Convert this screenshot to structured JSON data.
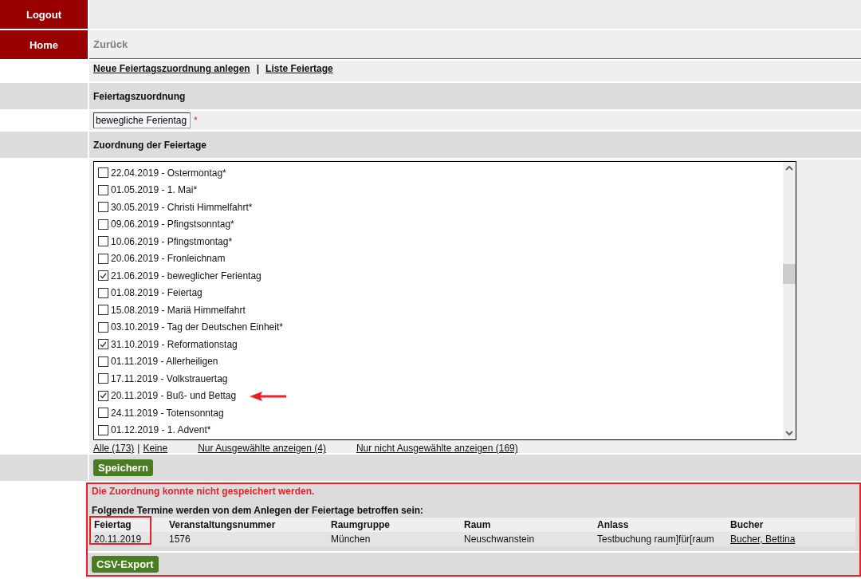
{
  "nav": [
    {
      "label": "Logout"
    },
    {
      "label": "Home"
    }
  ],
  "back_link": "Zurück",
  "links": [
    {
      "label": "Neue Feiertagszuordnung anlegen"
    },
    {
      "label": "Liste Feiertage"
    }
  ],
  "link_separator": "|",
  "assignment": {
    "title": "Feiertagszuordnung",
    "value": "bewegliche Ferientag",
    "required_mark": "*"
  },
  "holidays": {
    "title": "Zuordnung der Feiertage",
    "items": [
      {
        "label": "22.04.2019 - Ostermontag*",
        "checked": false
      },
      {
        "label": "01.05.2019 - 1. Mai*",
        "checked": false
      },
      {
        "label": "30.05.2019 - Christi Himmelfahrt*",
        "checked": false
      },
      {
        "label": "09.06.2019 - Pfingstsonntag*",
        "checked": false
      },
      {
        "label": "10.06.2019 - Pfingstmontag*",
        "checked": false
      },
      {
        "label": "20.06.2019 - Fronleichnam",
        "checked": false
      },
      {
        "label": "21.06.2019 - beweglicher Ferientag",
        "checked": true
      },
      {
        "label": "01.08.2019 - Feiertag",
        "checked": false
      },
      {
        "label": "15.08.2019 - Mariä Himmelfahrt",
        "checked": false
      },
      {
        "label": "03.10.2019 - Tag der Deutschen Einheit*",
        "checked": false
      },
      {
        "label": "31.10.2019 - Reformationstag",
        "checked": true
      },
      {
        "label": "01.11.2019 - Allerheiligen",
        "checked": false
      },
      {
        "label": "17.11.2019 - Volkstrauertag",
        "checked": false
      },
      {
        "label": "20.11.2019 - Buß- und Bettag",
        "checked": true
      },
      {
        "label": "24.11.2019 - Totensonntag",
        "checked": false
      },
      {
        "label": "01.12.2019 - 1. Advent*",
        "checked": false
      }
    ],
    "filters": [
      {
        "label": "Alle (173)"
      },
      {
        "label": "|"
      },
      {
        "label": "Keine"
      },
      {
        "label": "Nur Ausgewählte anzeigen (4)"
      },
      {
        "label": "Nur nicht Ausgewählte anzeigen (169)"
      }
    ]
  },
  "save_button": "Speichern",
  "error": "Die Zuordnung konnte nicht gespeichert werden.",
  "info": "Folgende Termine werden von dem Anlegen der Feiertage betroffen sein:",
  "table": {
    "columns": [
      "Feiertag",
      "Veranstaltungsnummer",
      "Raumgruppe",
      "Raum",
      "Anlass",
      "Bucher"
    ],
    "rows": [
      [
        "20.11.2019",
        "1576",
        "München",
        "Neuschwanstein",
        "Testbuchung raum]für[raum",
        "Bucher, Bettina"
      ]
    ]
  },
  "export_button": "CSV-Export"
}
